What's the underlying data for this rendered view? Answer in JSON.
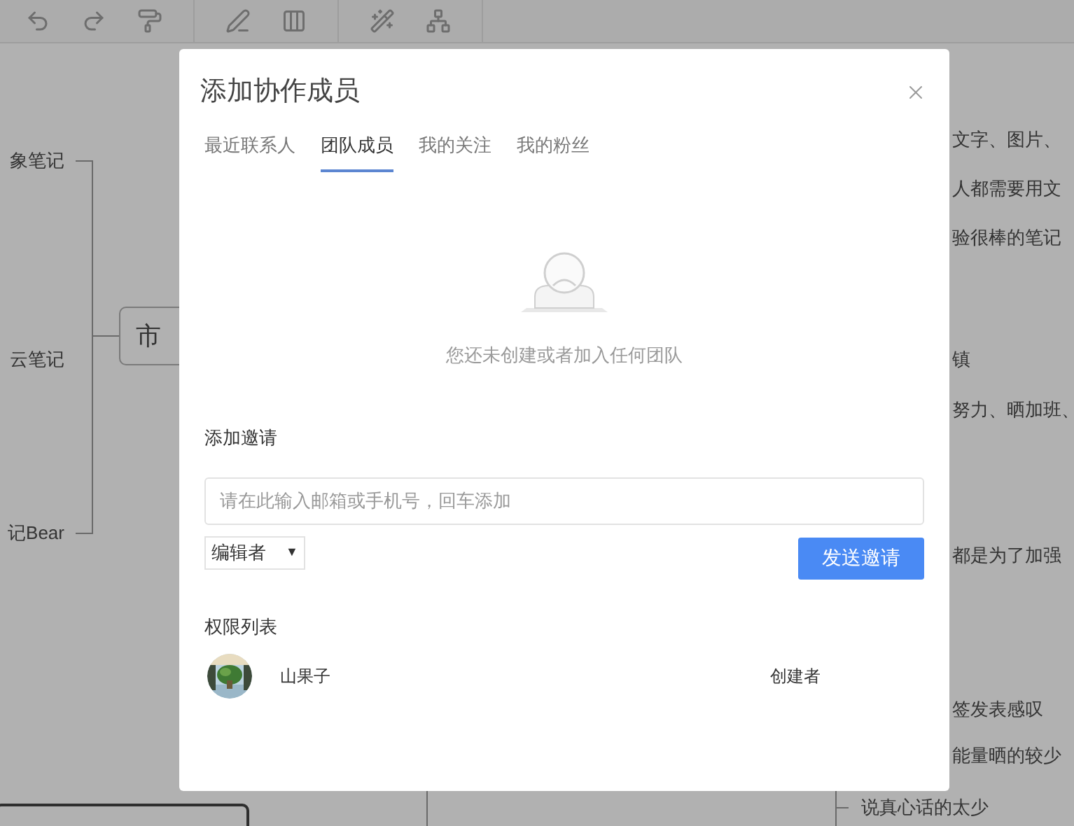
{
  "mind_map": {
    "left_nodes": [
      "象笔记",
      "云笔记",
      "记Bear"
    ],
    "center_node": "市",
    "right_nodes": [
      "文字、图片、",
      "人都需要用文",
      "验很棒的笔记",
      "镇",
      "努力、晒加班、",
      "都是为了加强",
      "签发表感叹",
      "能量晒的较少"
    ],
    "bottom_node": "说真心话的太少"
  },
  "dialog": {
    "title": "添加协作成员",
    "tabs": [
      {
        "label": "最近联系人",
        "selected": false
      },
      {
        "label": "团队成员",
        "selected": true
      },
      {
        "label": "我的关注",
        "selected": false
      },
      {
        "label": "我的粉丝",
        "selected": false
      }
    ],
    "empty_message": "您还未创建或者加入任何团队",
    "invite": {
      "label": "添加邀请",
      "placeholder": "请在此输入邮箱或手机号，回车添加",
      "role": "编辑者",
      "dropdown_arrow": "▼",
      "send_button": "发送邀请"
    },
    "permissions": {
      "label": "权限列表",
      "members": [
        {
          "name": "山果子",
          "role": "创建者"
        }
      ]
    }
  }
}
